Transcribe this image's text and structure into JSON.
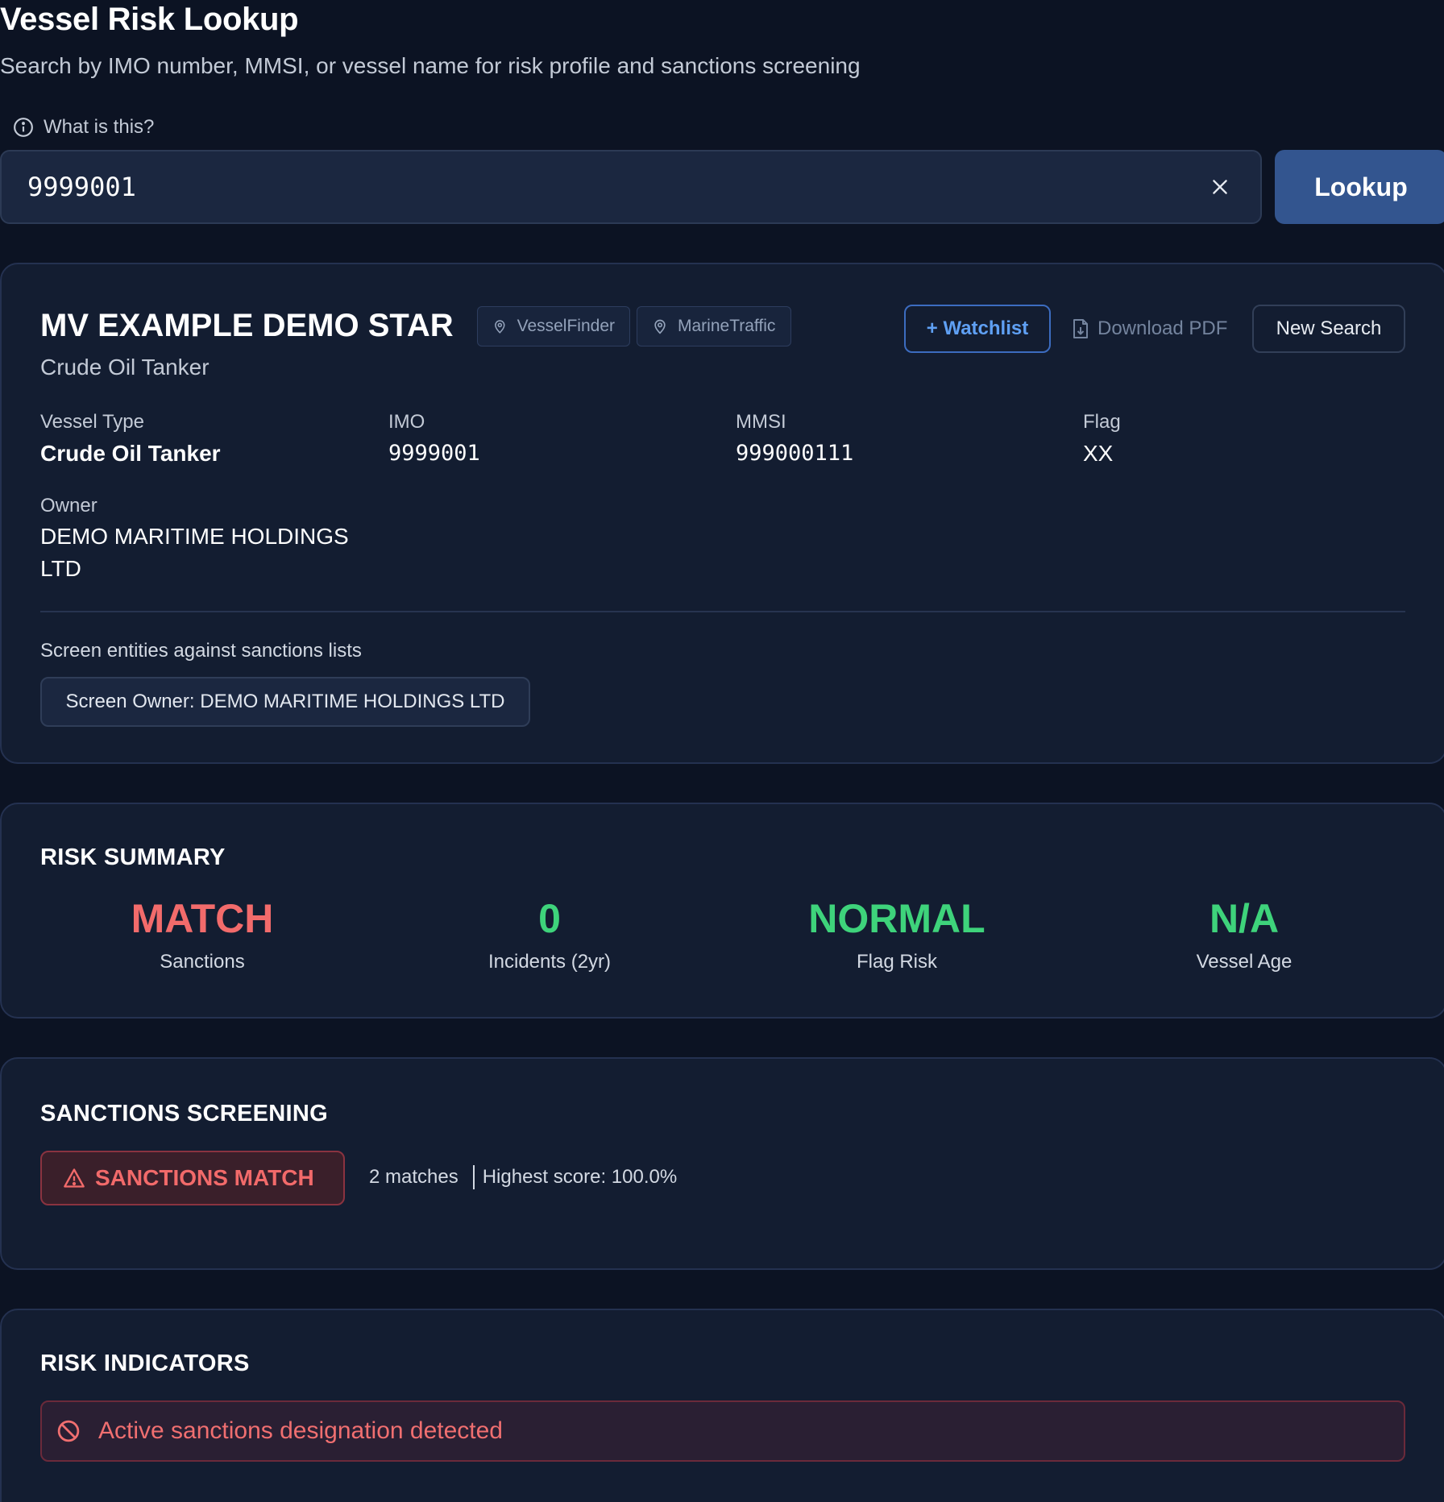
{
  "header": {
    "title": "Vessel Risk Lookup",
    "subtitle": "Search by IMO number, MMSI, or vessel name for risk profile and sanctions screening",
    "help_label": "What is this?"
  },
  "search": {
    "value": "9999001",
    "button_label": "Lookup"
  },
  "vessel": {
    "name": "MV EXAMPLE DEMO STAR",
    "subtitle": "Crude Oil Tanker",
    "links": [
      "VesselFinder",
      "MarineTraffic"
    ],
    "actions": {
      "watchlist_label": "+ Watchlist",
      "download_label": "Download PDF",
      "new_search_label": "New Search"
    },
    "fields": {
      "vessel_type": {
        "label": "Vessel Type",
        "value": "Crude Oil Tanker"
      },
      "imo": {
        "label": "IMO",
        "value": "9999001"
      },
      "mmsi": {
        "label": "MMSI",
        "value": "999000111"
      },
      "flag": {
        "label": "Flag",
        "value": "XX"
      },
      "owner": {
        "label": "Owner",
        "value_line1": "DEMO MARITIME HOLDINGS",
        "value_line2": "LTD"
      }
    },
    "screening": {
      "label": "Screen entities against sanctions lists",
      "button_label": "Screen Owner: DEMO MARITIME HOLDINGS LTD"
    }
  },
  "risk_summary": {
    "title": "RISK SUMMARY",
    "metrics": [
      {
        "value": "MATCH",
        "label": "Sanctions",
        "color": "#f26b6b"
      },
      {
        "value": "0",
        "label": "Incidents (2yr)",
        "color": "#3ed37b"
      },
      {
        "value": "NORMAL",
        "label": "Flag Risk",
        "color": "#3ed37b"
      },
      {
        "value": "N/A",
        "label": "Vessel Age",
        "color": "#3ed37b"
      }
    ]
  },
  "sanctions_screening": {
    "title": "SANCTIONS SCREENING",
    "badge_label": "SANCTIONS MATCH",
    "matches_text": "2 matches",
    "score_text": "Highest score: 100.0%"
  },
  "risk_indicators": {
    "title": "RISK INDICATORS",
    "items": [
      "Active sanctions designation detected"
    ]
  },
  "colors": {
    "background": "#0c1323",
    "card": "#131d31",
    "accent": "#33558f",
    "danger": "#f26b6b",
    "success": "#3ed37b"
  },
  "icons": [
    "info-icon",
    "close-icon",
    "map-pin-icon",
    "file-download-icon",
    "warning-triangle-icon",
    "ban-icon"
  ]
}
